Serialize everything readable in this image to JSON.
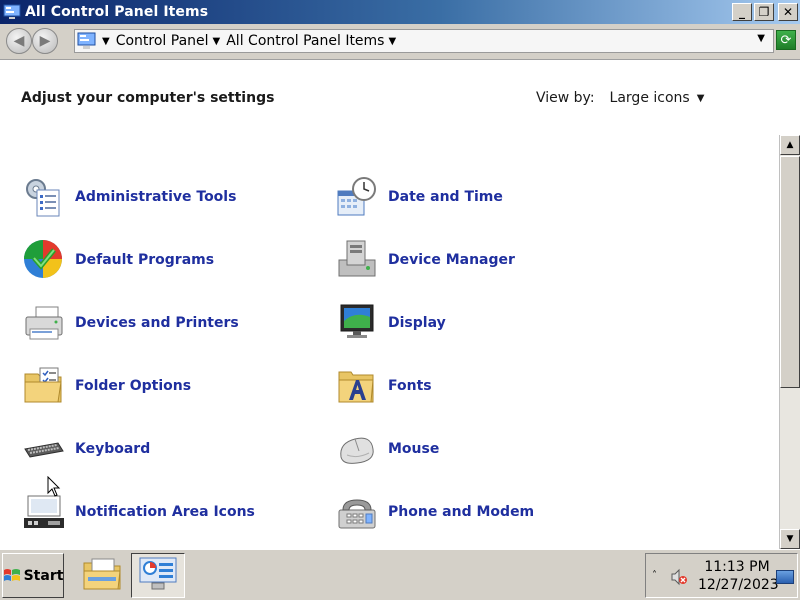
{
  "window": {
    "title": "All Control Panel Items",
    "buttons": {
      "minimize": "_",
      "restore": "❐",
      "close": "✕"
    }
  },
  "address": {
    "crumbs": [
      "Control Panel",
      "All Control Panel Items"
    ],
    "back_symbol": "◀",
    "forward_symbol": "▶",
    "dropdown_symbol": "▼",
    "crumb_separator": "▼",
    "refresh_symbol": "⟳"
  },
  "content": {
    "heading": "Adjust your computer's settings",
    "view_by_label": "View by:",
    "view_by_value": "Large icons",
    "dropdown_symbol": "▼"
  },
  "items": [
    {
      "label": "Administrative Tools",
      "icon": "administrative-tools-icon"
    },
    {
      "label": "Date and Time",
      "icon": "date-and-time-icon"
    },
    {
      "label": "Default Programs",
      "icon": "default-programs-icon"
    },
    {
      "label": "Device Manager",
      "icon": "device-manager-icon"
    },
    {
      "label": "Devices and Printers",
      "icon": "devices-and-printers-icon"
    },
    {
      "label": "Display",
      "icon": "display-icon"
    },
    {
      "label": "Folder Options",
      "icon": "folder-options-icon"
    },
    {
      "label": "Fonts",
      "icon": "fonts-icon"
    },
    {
      "label": "Keyboard",
      "icon": "keyboard-icon"
    },
    {
      "label": "Mouse",
      "icon": "mouse-icon"
    },
    {
      "label": "Notification Area Icons",
      "icon": "notification-area-icons-icon"
    },
    {
      "label": "Phone and Modem",
      "icon": "phone-and-modem-icon"
    }
  ],
  "scrollbar": {
    "up": "▲",
    "down": "▼",
    "position": 0.0
  },
  "taskbar": {
    "start_label": "Start",
    "tray_chevron": "˄",
    "time": "11:13 PM",
    "date": "12/27/2023"
  },
  "colors": {
    "link": "#1f2f9f",
    "title_bar_start": "#0a246a",
    "title_bar_end": "#a6caf0",
    "chrome": "#d4d0c8"
  }
}
